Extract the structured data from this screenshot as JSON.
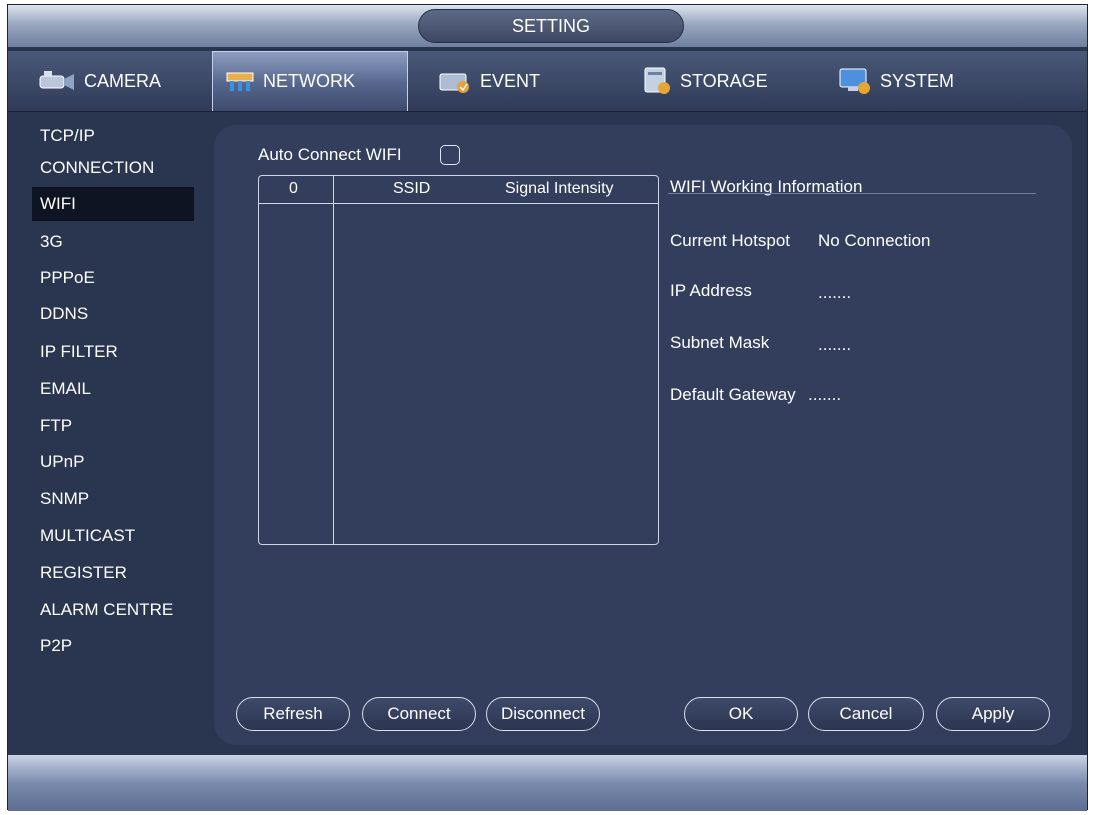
{
  "window": {
    "title": "SETTING"
  },
  "tabs": [
    {
      "label": "CAMERA",
      "icon": "camera-icon"
    },
    {
      "label": "NETWORK",
      "icon": "network-icon",
      "active": true
    },
    {
      "label": "EVENT",
      "icon": "event-icon"
    },
    {
      "label": "STORAGE",
      "icon": "storage-icon"
    },
    {
      "label": "SYSTEM",
      "icon": "system-icon"
    }
  ],
  "sidebar": {
    "items": [
      {
        "label": "TCP/IP"
      },
      {
        "label": "CONNECTION"
      },
      {
        "label": "WIFI",
        "active": true
      },
      {
        "label": "3G"
      },
      {
        "label": "PPPoE"
      },
      {
        "label": "DDNS"
      },
      {
        "label": "IP FILTER"
      },
      {
        "label": "EMAIL"
      },
      {
        "label": "FTP"
      },
      {
        "label": "UPnP"
      },
      {
        "label": "SNMP"
      },
      {
        "label": "MULTICAST"
      },
      {
        "label": "REGISTER"
      },
      {
        "label": "ALARM CENTRE"
      },
      {
        "label": "P2P"
      }
    ]
  },
  "wifi": {
    "auto_connect_label": "Auto Connect WIFI",
    "auto_connect_checked": false,
    "table": {
      "columns": [
        "0",
        "SSID",
        "Signal Intensity"
      ],
      "rows": []
    },
    "info": {
      "heading": "WIFI Working Information",
      "current_hotspot_label": "Current Hotspot",
      "current_hotspot_value": "No Connection",
      "ip_address_label": "IP Address",
      "ip_address_value": ".......",
      "subnet_mask_label": "Subnet Mask",
      "subnet_mask_value": ".......",
      "default_gateway_label": "Default Gateway",
      "default_gateway_value": "......."
    }
  },
  "buttons": {
    "refresh": "Refresh",
    "connect": "Connect",
    "disconnect": "Disconnect",
    "ok": "OK",
    "cancel": "Cancel",
    "apply": "Apply"
  },
  "colors": {
    "background": "#2a3550",
    "panel": "#323e5c",
    "selected_item": "#0f1422",
    "text": "#ffffff"
  }
}
